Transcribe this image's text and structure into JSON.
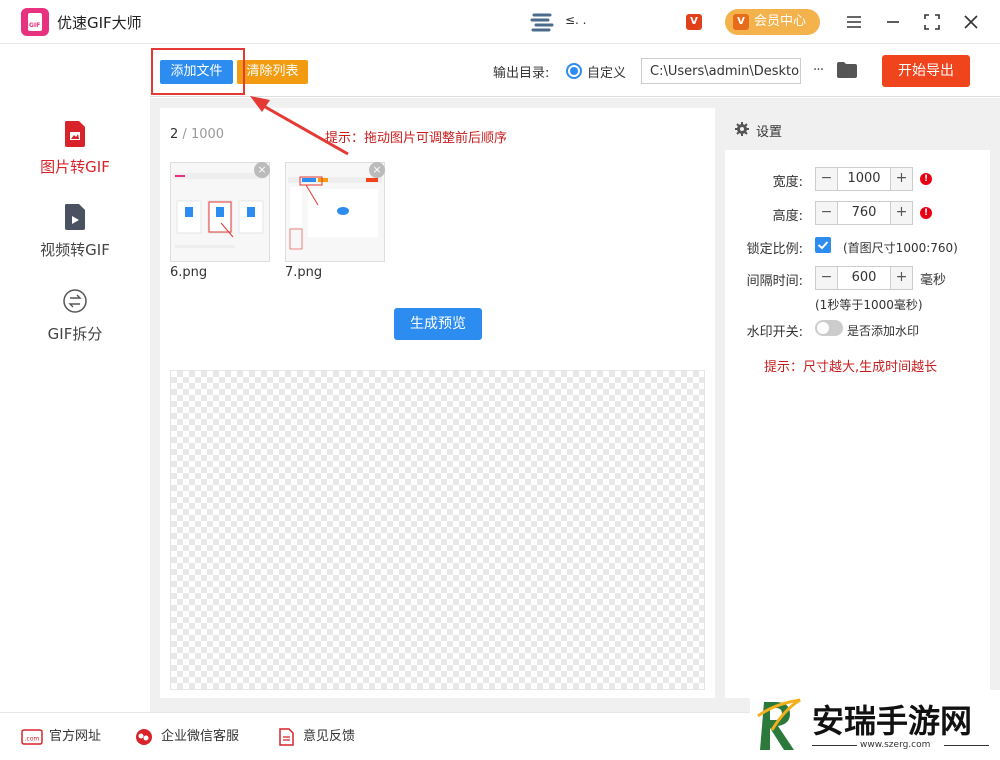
{
  "app": {
    "title": "优速GIF大师",
    "logo_text": "GIF"
  },
  "user": {
    "name": "≤. ."
  },
  "header": {
    "vip_badge": "V",
    "member_label": "会员中心"
  },
  "toolbar": {
    "add_label": "添加文件",
    "clear_label": "清除列表",
    "output_label": "输出目录:",
    "radio_label": "自定义",
    "path_value": "C:\\Users\\admin\\Deskto",
    "more_label": "···",
    "export_label": "开始导出"
  },
  "sidebar": {
    "items": [
      {
        "label": "图片转GIF",
        "active": true
      },
      {
        "label": "视频转GIF",
        "active": false
      },
      {
        "label": "GIF拆分",
        "active": false
      }
    ]
  },
  "files": {
    "count_current": "2",
    "count_sep": " / ",
    "count_total": "1000",
    "hint": "提示：拖动图片可调整前后顺序",
    "items": [
      {
        "name": "6.png"
      },
      {
        "name": "7.png"
      }
    ],
    "preview_label": "生成预览"
  },
  "settings": {
    "title": "设置",
    "width_label": "宽度:",
    "width_value": "1000",
    "height_label": "高度:",
    "height_value": "760",
    "lock_label": "锁定比例:",
    "lock_note": "(首图尺寸1000:760)",
    "interval_label": "间隔时间:",
    "interval_value": "600",
    "interval_unit": "毫秒",
    "interval_note": "(1秒等于1000毫秒)",
    "watermark_label": "水印开关:",
    "watermark_note": "是否添加水印",
    "hint": "提示：尺寸越大,生成时间越长"
  },
  "footer": {
    "website": "官方网址",
    "wechat": "企业微信客服",
    "feedback": "意见反馈"
  },
  "watermark": {
    "text": "安瑞手游网",
    "url": "www.szerg.com"
  },
  "colors": {
    "primary": "#2d8cf0",
    "orange": "#f39c12",
    "export": "#f0441c",
    "active": "#d8232a",
    "hint": "#c81e1e"
  }
}
